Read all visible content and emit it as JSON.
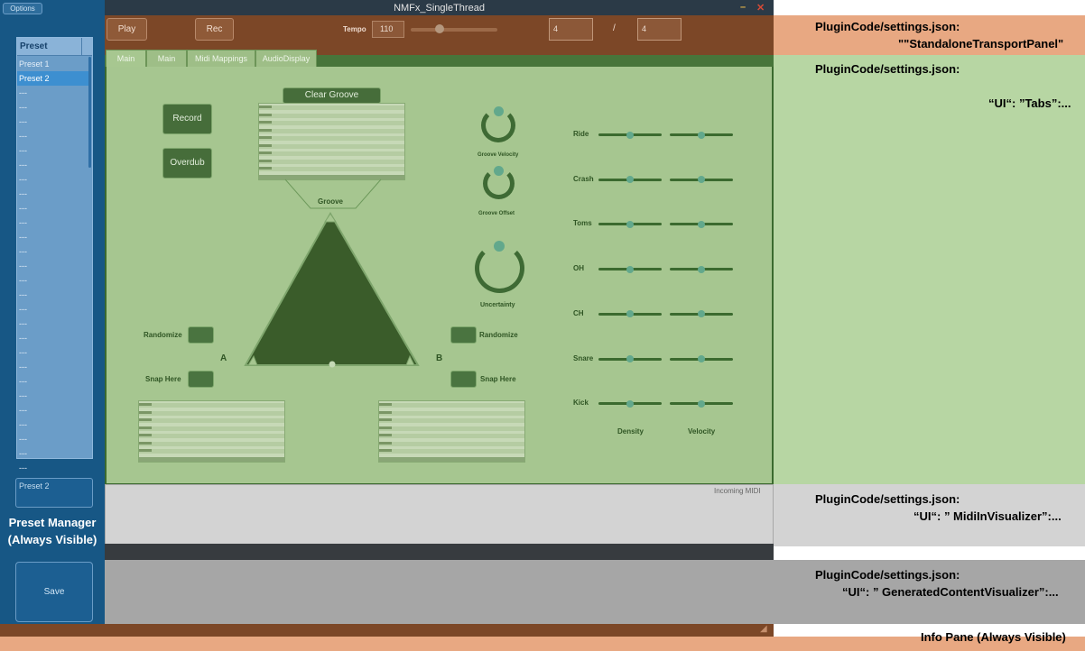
{
  "window": {
    "title": "NMFx_SingleThread"
  },
  "preset_manager": {
    "options_label": "Options",
    "header": "Preset",
    "items": [
      "Preset 1",
      "Preset 2",
      "---",
      "---",
      "---",
      "---",
      "---",
      "---",
      "---",
      "---",
      "---",
      "---",
      "---",
      "---",
      "---",
      "---",
      "---",
      "---",
      "---",
      "---",
      "---",
      "---",
      "---",
      "---",
      "---",
      "---",
      "---",
      "---",
      "---"
    ],
    "selected_index": 1,
    "current_preset": "Preset 2",
    "label_line1": "Preset Manager",
    "label_line2": "(Always Visible)",
    "save_label": "Save"
  },
  "transport": {
    "play_label": "Play",
    "rec_label": "Rec",
    "tempo_label": "Tempo",
    "tempo_value": "110",
    "time_sig_num": "4",
    "time_sig_sep": "/",
    "time_sig_den": "4"
  },
  "tabs": [
    {
      "label": "Main"
    },
    {
      "label": "Main"
    },
    {
      "label": "Midi Mappings"
    },
    {
      "label": "AudioDisplay"
    }
  ],
  "main": {
    "record_label": "Record",
    "overdub_label": "Overdub",
    "clear_groove_label": "Clear Groove",
    "groove_label": "Groove",
    "groove_velocity_label": "Groove Velocity",
    "groove_offset_label": "Groove Offset",
    "uncertainty_label": "Uncertainty",
    "randomize_left_label": "Randomize",
    "snap_left_label": "Snap Here",
    "randomize_right_label": "Randomize",
    "snap_right_label": "Snap Here",
    "a_label": "A",
    "b_label": "B",
    "instruments": [
      "Ride",
      "Crash",
      "Toms",
      "OH",
      "CH",
      "Snare",
      "Kick"
    ],
    "density_label": "Density",
    "velocity_label": "Velocity"
  },
  "midi_in": {
    "title": "Incoming MIDI"
  },
  "info": {
    "label": "Info Pane (Always Visible)"
  },
  "annotations": {
    "transport_line1": "PluginCode/settings.json:",
    "transport_line2": "\"\"StandaloneTransportPanel\"",
    "tabs_line1": "PluginCode/settings.json:",
    "tabs_line2": "“UI“: ”Tabs”:...",
    "midi_line1": "PluginCode/settings.json:",
    "midi_line2": "“UI“: ” MidiInVisualizer”:...",
    "gen_line1": "PluginCode/settings.json:",
    "gen_line2": "“UI“: ” GeneratedContentVisualizer”:..."
  },
  "colors": {
    "transport_annotation": "#e8a882",
    "tabs_annotation": "#b7d6a3",
    "midi_annotation": "#d3d3d3",
    "generated_annotation": "#a6a6a6",
    "info_annotation": "#e8a882"
  }
}
